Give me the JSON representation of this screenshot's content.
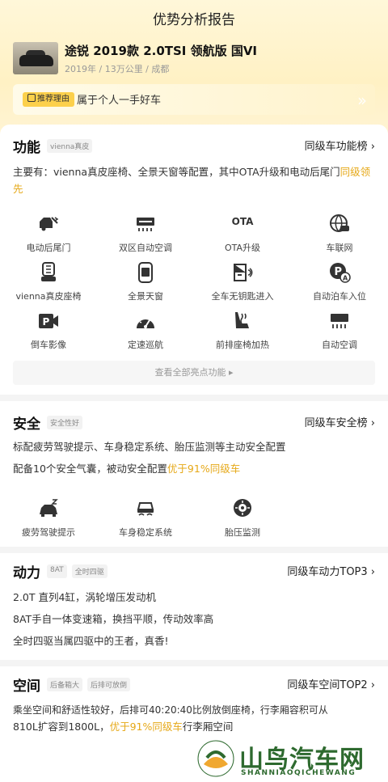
{
  "header": {
    "title": "优势分析报告",
    "car_name": "途锐 2019款 2.0TSI 领航版 国VI",
    "car_meta": "2019年 / 13万公里 / 成都",
    "reason_tag": "推荐理由",
    "reason_text": "属于个人一手好车"
  },
  "features": {
    "title": "功能",
    "tag": "vienna真皮",
    "link": "同级车功能榜 ›",
    "desc_main": "主要有：vienna真皮座椅、全景天窗等配置，其中OTA升级和电动后尾门",
    "desc_hl": "同级领先",
    "items": [
      {
        "label": "电动后尾门",
        "icon": "tailgate-icon"
      },
      {
        "label": "双区自动空调",
        "icon": "dual-ac-icon"
      },
      {
        "label": "OTA升级",
        "icon": "ota-icon",
        "glyph": "OTA"
      },
      {
        "label": "车联网",
        "icon": "connected-car-icon"
      },
      {
        "label": "vienna真皮座椅",
        "icon": "leather-seat-icon"
      },
      {
        "label": "全景天窗",
        "icon": "sunroof-icon"
      },
      {
        "label": "全车无钥匙进入",
        "icon": "keyless-entry-icon"
      },
      {
        "label": "自动泊车入位",
        "icon": "auto-parking-icon"
      },
      {
        "label": "倒车影像",
        "icon": "rear-camera-icon"
      },
      {
        "label": "定速巡航",
        "icon": "cruise-control-icon"
      },
      {
        "label": "前排座椅加热",
        "icon": "seat-heating-icon"
      },
      {
        "label": "自动空调",
        "icon": "auto-ac-icon"
      }
    ],
    "more": "查看全部亮点功能 ▸"
  },
  "safety": {
    "title": "安全",
    "tag": "安全性好",
    "link": "同级车安全榜 ›",
    "line1": "标配疲劳驾驶提示、车身稳定系统、胎压监测等主动安全配置",
    "line2_pre": "配备10个安全气囊，被动安全配置",
    "line2_hl": "优于91%同级车",
    "items": [
      {
        "label": "疲劳驾驶提示",
        "icon": "fatigue-alert-icon"
      },
      {
        "label": "车身稳定系统",
        "icon": "stability-control-icon"
      },
      {
        "label": "胎压监测",
        "icon": "tire-pressure-icon"
      }
    ]
  },
  "power": {
    "title": "动力",
    "tags": [
      "8AT",
      "全时四驱"
    ],
    "link": "同级车动力TOP3 ›",
    "lines": [
      "2.0T 直列4缸，涡轮增压发动机",
      "8AT手自一体变速箱，换挡平顺，传动效率高",
      "全时四驱当属四驱中的王者，真香!"
    ]
  },
  "space": {
    "title": "空间",
    "tags": [
      "后备箱大",
      "后排可放倒"
    ],
    "link": "同级车空间TOP2 ›",
    "line1": "乘坐空间和舒适性较好，后排可40:20:40比例放倒座椅，行李厢容积可从",
    "line2_pre": "810L扩容到1800L，",
    "line2_hl": "优于91%同级车",
    "line2_post": "行李厢空间"
  },
  "watermark": {
    "cn": "山鸟汽车网",
    "en": "SHANNIAOQICHEWANG"
  },
  "colors": {
    "accent": "#fcd04b",
    "highlight": "#e6a817",
    "watermark": "#2e6a2f"
  }
}
